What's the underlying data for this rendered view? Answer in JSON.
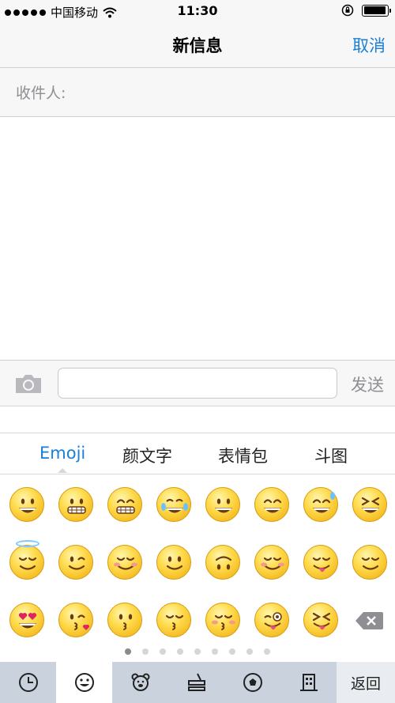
{
  "status_bar": {
    "carrier": "中国移动",
    "time": "11:30",
    "battery_level": 0.95
  },
  "nav": {
    "title": "新信息",
    "cancel_label": "取消"
  },
  "recipients": {
    "label": "收件人:"
  },
  "input_bar": {
    "message_value": "",
    "send_label": "发送"
  },
  "categories": [
    {
      "label": "Emoji",
      "active": true
    },
    {
      "label": "颜文字",
      "active": false
    },
    {
      "label": "表情包",
      "active": false
    },
    {
      "label": "斗图",
      "active": false
    }
  ],
  "emoji_grid": [
    [
      "grinning-face",
      "grimacing-face",
      "grin-face",
      "tears-of-joy-face",
      "smiley-face",
      "smile-face",
      "sweat-smile-face",
      "laughing-face"
    ],
    [
      "innocent-face",
      "wink-face",
      "blush-face",
      "slight-smile-face",
      "upside-down-face",
      "relaxed-face",
      "yum-face",
      "relieved-face"
    ],
    [
      "heart-eyes-face",
      "kissing-heart-face",
      "kissing-face",
      "kissing-smiling-eyes-face",
      "kissing-closed-eyes-face",
      "tongue-wink-face",
      "tongue-closed-eyes-face"
    ]
  ],
  "pager": {
    "pages": 9,
    "current": 1
  },
  "toolbar": {
    "items": [
      "clock-icon",
      "smiley-icon",
      "bear-icon",
      "food-icon",
      "soccer-ball-icon",
      "building-icon"
    ],
    "active_index": 1,
    "back_label": "返回"
  },
  "colors": {
    "accent": "#1a7fd6",
    "toolbar_bg": "#c9d2dd",
    "bar_bg": "#f7f7f7"
  }
}
